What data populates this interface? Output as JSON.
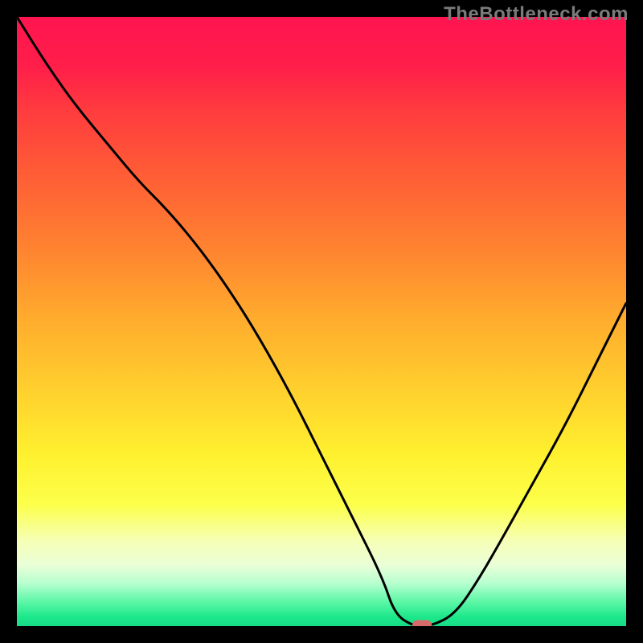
{
  "watermark": "TheBottleneck.com",
  "chart_data": {
    "type": "line",
    "title": "",
    "xlabel": "",
    "ylabel": "",
    "xlim": [
      0,
      100
    ],
    "ylim": [
      0,
      100
    ],
    "grid": false,
    "background_gradient": {
      "top": "#ff1450",
      "bottom": "#17db86",
      "stops": [
        "red",
        "orange",
        "yellow",
        "green"
      ]
    },
    "series": [
      {
        "name": "bottleneck-curve",
        "color": "#000000",
        "x": [
          0,
          5,
          10,
          15,
          20,
          25,
          30,
          35,
          40,
          45,
          50,
          55,
          60,
          62,
          65,
          68,
          72,
          76,
          80,
          85,
          90,
          95,
          100
        ],
        "values": [
          100,
          92,
          85,
          79,
          73,
          68,
          62,
          55,
          47,
          38,
          28,
          18,
          8,
          2,
          0,
          0,
          2,
          8,
          15,
          24,
          33,
          43,
          53
        ]
      }
    ],
    "marker": {
      "name": "optimal-point",
      "x": 66.5,
      "y": 0,
      "color": "#d86a6a",
      "shape": "rounded-rect"
    }
  }
}
